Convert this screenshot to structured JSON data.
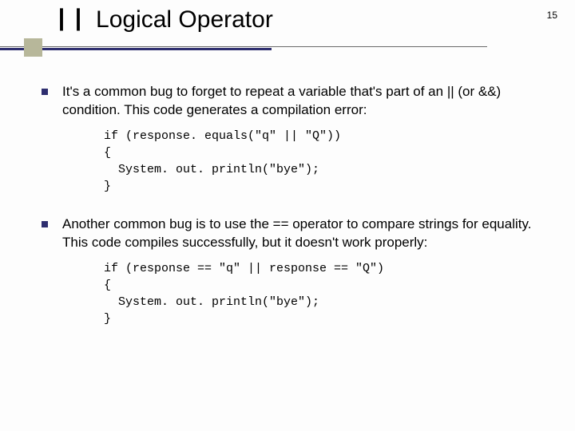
{
  "page_number": "15",
  "title": {
    "prefix": "||",
    "text": "Logical Operator"
  },
  "bullets": [
    {
      "text": "It's a common bug to forget to repeat a variable that's part of an || (or &&) condition. This code generates a compilation error:",
      "code": "if (response. equals(\"q\" || \"Q\"))\n{\n  System. out. println(\"bye\");\n}"
    },
    {
      "text": "Another common bug is to use the == operator to compare strings for equality. This code compiles successfully, but it doesn't work properly:",
      "code": "if (response == \"q\" || response == \"Q\")\n{\n  System. out. println(\"bye\");\n}"
    }
  ]
}
